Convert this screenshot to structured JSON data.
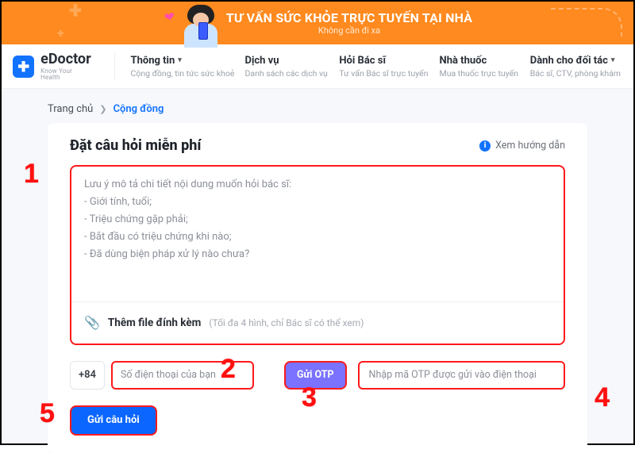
{
  "banner": {
    "title": "TƯ VẤN SỨC KHỎE TRỰC TUYẾN TẠI NHÀ",
    "subtitle": "Không cần đi xa"
  },
  "logo": {
    "name": "eDoctor",
    "tagline": "Know Your Health"
  },
  "nav": [
    {
      "title": "Thông tin",
      "subtitle": "Cộng đồng, tin tức sức khoẻ",
      "dropdown": true
    },
    {
      "title": "Dịch vụ",
      "subtitle": "Danh sách các dịch vụ",
      "dropdown": false
    },
    {
      "title": "Hỏi Bác sĩ",
      "subtitle": "Tư vấn Bác sĩ trực tuyến",
      "dropdown": false
    },
    {
      "title": "Nhà thuốc",
      "subtitle": "Mua thuốc trực tuyến",
      "dropdown": false
    },
    {
      "title": "Dành cho đối tác",
      "subtitle": "Bác sĩ, CTV, phòng khám",
      "dropdown": true
    }
  ],
  "breadcrumbs": {
    "home": "Trang chủ",
    "arrow": "❯",
    "current": "Cộng đồng"
  },
  "card": {
    "title": "Đặt câu hỏi miễn phí",
    "guide": "Xem hướng dẫn",
    "placeholder_lines": [
      "Lưu ý mô tả chi tiết nội dung muốn hỏi bác sĩ:",
      "- Giới tính, tuổi;",
      "- Triệu chứng gặp phải;",
      "- Bắt đầu có triệu chứng khi nào;",
      "- Đã dùng biện pháp xử lý nào chưa?"
    ],
    "attach_label": "Thêm file đính kèm",
    "attach_note": "(Tối đa 4 hình, chỉ Bác sĩ có thể xem)"
  },
  "form": {
    "country_code": "+84",
    "phone_placeholder": "Số điện thoại của bạn",
    "otp_button": "Gửi OTP",
    "otp_placeholder": "Nhập mã OTP được gửi vào điện thoại",
    "submit": "Gửi câu hỏi"
  },
  "annotations": {
    "a1": "1",
    "a2": "2",
    "a3": "3",
    "a4": "4",
    "a5": "5"
  }
}
